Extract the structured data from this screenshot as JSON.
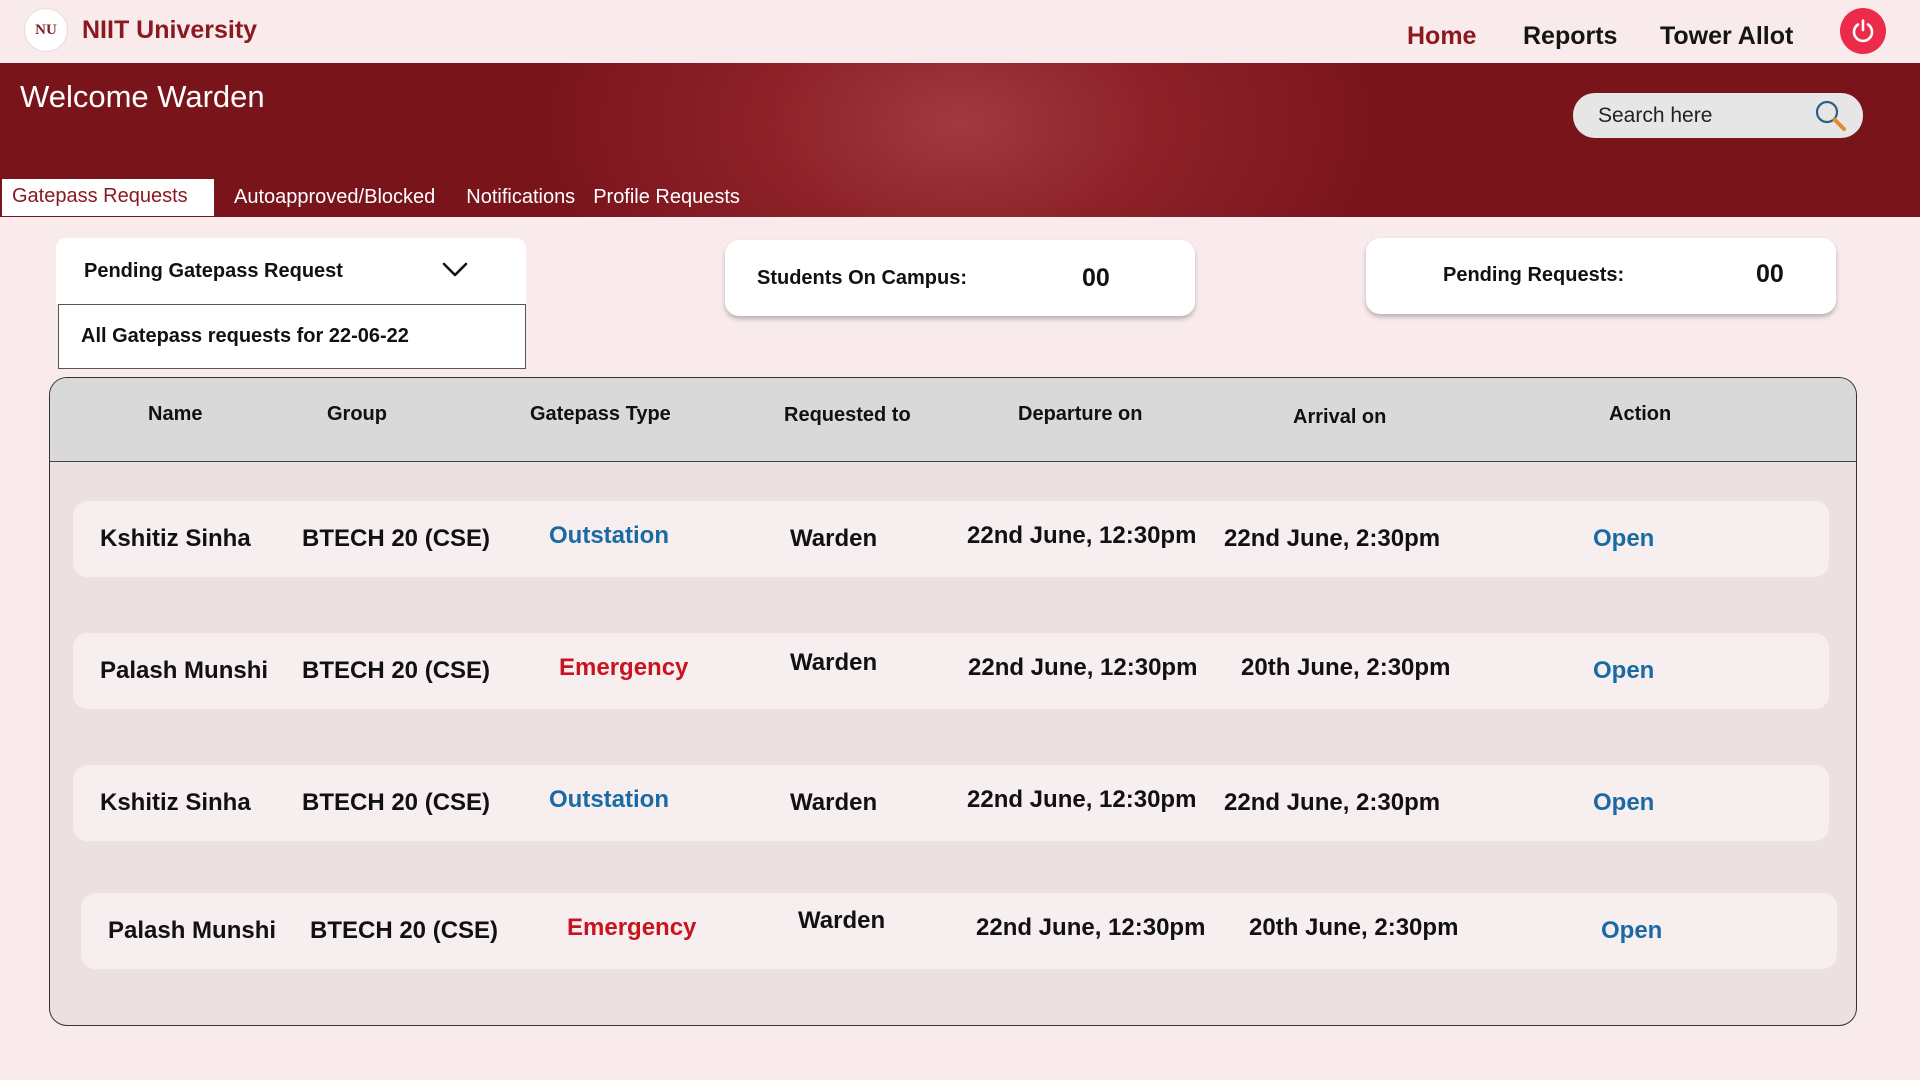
{
  "brand": {
    "logo_text": "NU",
    "name": "NIIT University"
  },
  "nav": {
    "home": "Home",
    "reports": "Reports",
    "tower_allot": "Tower Allot"
  },
  "banner": {
    "welcome": "Welcome Warden"
  },
  "search": {
    "placeholder": "Search here"
  },
  "tabs": [
    "Gatepass Requests",
    "Autoapproved/Blocked",
    "Notifications",
    "Profile Requests"
  ],
  "filter": {
    "selected": "Pending Gatepass Request",
    "option": "All Gatepass requests for  22-06-22"
  },
  "stats": {
    "students_on_campus_label": "Students On Campus:",
    "students_on_campus_value": "00",
    "pending_requests_label": "Pending Requests:",
    "pending_requests_value": "00"
  },
  "table": {
    "headers": [
      "Name",
      "Group",
      "Gatepass Type",
      "Requested to",
      "Departure on",
      "Arrival on",
      "Action"
    ],
    "rows": [
      {
        "name": "Kshitiz Sinha",
        "group": "BTECH 20 (CSE)",
        "type": "Outstation",
        "requested_to": "Warden",
        "departure": "22nd June, 12:30pm",
        "arrival": "22nd June, 2:30pm",
        "action": "Open"
      },
      {
        "name": "Palash Munshi",
        "group": "BTECH 20 (CSE)",
        "type": "Emergency",
        "requested_to": "Warden",
        "departure": "22nd June, 12:30pm",
        "arrival": "20th June, 2:30pm",
        "action": "Open"
      },
      {
        "name": "Kshitiz Sinha",
        "group": "BTECH 20 (CSE)",
        "type": "Outstation",
        "requested_to": "Warden",
        "departure": "22nd June, 12:30pm",
        "arrival": "22nd June, 2:30pm",
        "action": "Open"
      },
      {
        "name": "Palash Munshi",
        "group": "BTECH 20 (CSE)",
        "type": "Emergency",
        "requested_to": "Warden",
        "departure": "22nd June, 12:30pm",
        "arrival": "20th June, 2:30pm",
        "action": "Open"
      }
    ]
  },
  "colors": {
    "brand": "#8b1a20",
    "banner": "#8e2229",
    "outstation": "#1a6aa3",
    "emergency": "#c8141f",
    "power": "#ec2b4b"
  },
  "icons": {
    "power": "power-icon",
    "search": "search-icon",
    "dropdown": "chevron-down-icon"
  }
}
